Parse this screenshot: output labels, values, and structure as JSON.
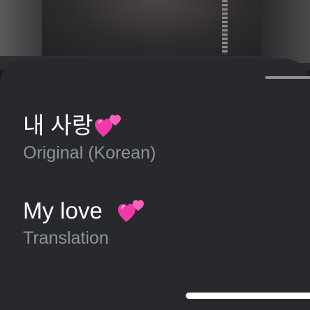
{
  "entries": {
    "original": {
      "text": "내 사랑",
      "label": "Original (Korean)",
      "emoji": "two-hearts-icon"
    },
    "translation": {
      "text": "My love ",
      "label": "Translation",
      "emoji": "two-hearts-icon"
    }
  },
  "colors": {
    "sheet_background": "#27292d",
    "primary_text": "#ffffff",
    "secondary_text": "#8e939b",
    "heart_pink": "#f03aa8"
  }
}
